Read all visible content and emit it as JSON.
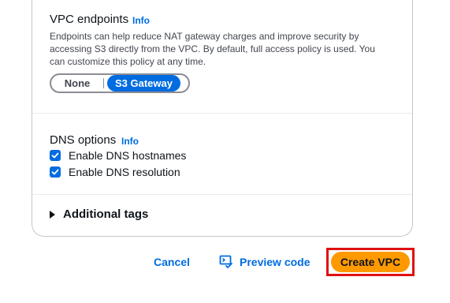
{
  "vpc_endpoints": {
    "title": "VPC endpoints",
    "info": "Info",
    "description": "Endpoints can help reduce NAT gateway charges and improve security by accessing S3 directly from the VPC. By default, full access policy is used. You can customize this policy at any time.",
    "options": [
      "None",
      "S3 Gateway"
    ],
    "selected": "S3 Gateway"
  },
  "dns_options": {
    "title": "DNS options",
    "info": "Info",
    "checkboxes": [
      {
        "label": "Enable DNS hostnames",
        "checked": true
      },
      {
        "label": "Enable DNS resolution",
        "checked": true
      }
    ]
  },
  "additional_tags": {
    "label": "Additional tags",
    "expanded": false
  },
  "footer": {
    "cancel_label": "Cancel",
    "preview_label": "Preview code",
    "create_label": "Create VPC"
  },
  "colors": {
    "link": "#006ce0",
    "primary": "#ff9900",
    "highlight": "#e01010"
  }
}
